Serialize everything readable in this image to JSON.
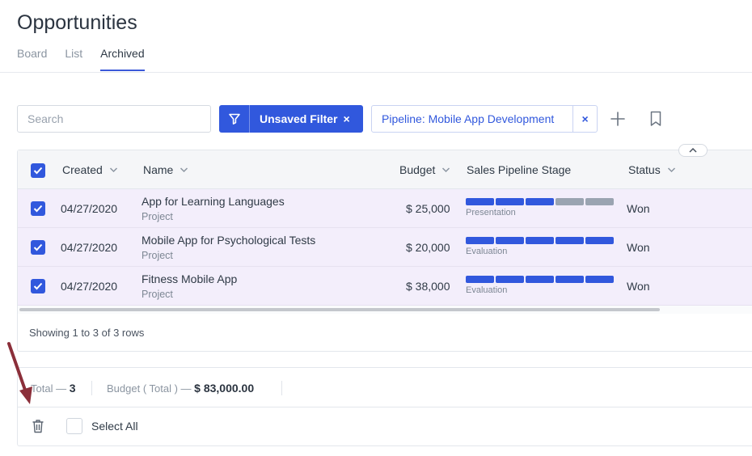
{
  "page": {
    "title": "Opportunities"
  },
  "tabs": [
    {
      "label": "Board",
      "active": false
    },
    {
      "label": "List",
      "active": false
    },
    {
      "label": "Archived",
      "active": true
    }
  ],
  "toolbar": {
    "search_placeholder": "Search",
    "filter_label": "Unsaved Filter",
    "filter_clear": "×",
    "pipeline_chip": "Pipeline: Mobile App Development",
    "pipeline_clear": "×"
  },
  "table": {
    "columns": {
      "created": "Created",
      "name": "Name",
      "budget": "Budget",
      "stage": "Sales Pipeline Stage",
      "status": "Status"
    },
    "rows": [
      {
        "created": "04/27/2020",
        "name": "App for Learning Languages",
        "type": "Project",
        "budget": "$ 25,000",
        "stage": "Presentation",
        "stage_progress": 3,
        "stage_total": 5,
        "status": "Won"
      },
      {
        "created": "04/27/2020",
        "name": "Mobile App for Psychological Tests",
        "type": "Project",
        "budget": "$ 20,000",
        "stage": "Evaluation",
        "stage_progress": 5,
        "stage_total": 5,
        "status": "Won"
      },
      {
        "created": "04/27/2020",
        "name": "Fitness Mobile App",
        "type": "Project",
        "budget": "$ 38,000",
        "stage": "Evaluation",
        "stage_progress": 5,
        "stage_total": 5,
        "status": "Won"
      }
    ],
    "showing": "Showing 1 to 3 of 3 rows"
  },
  "totals": {
    "total_label": "Total —",
    "total_value": "3",
    "budget_label": "Budget ( Total ) —",
    "budget_value": "$ 83,000.00"
  },
  "footer": {
    "select_all": "Select All"
  },
  "colors": {
    "accent": "#3158dd",
    "stage_done": "#3158dd",
    "stage_todo": "#9aa4b1",
    "row_selected": "#f3eefb",
    "annotation_arrow": "#8b2f3a"
  }
}
